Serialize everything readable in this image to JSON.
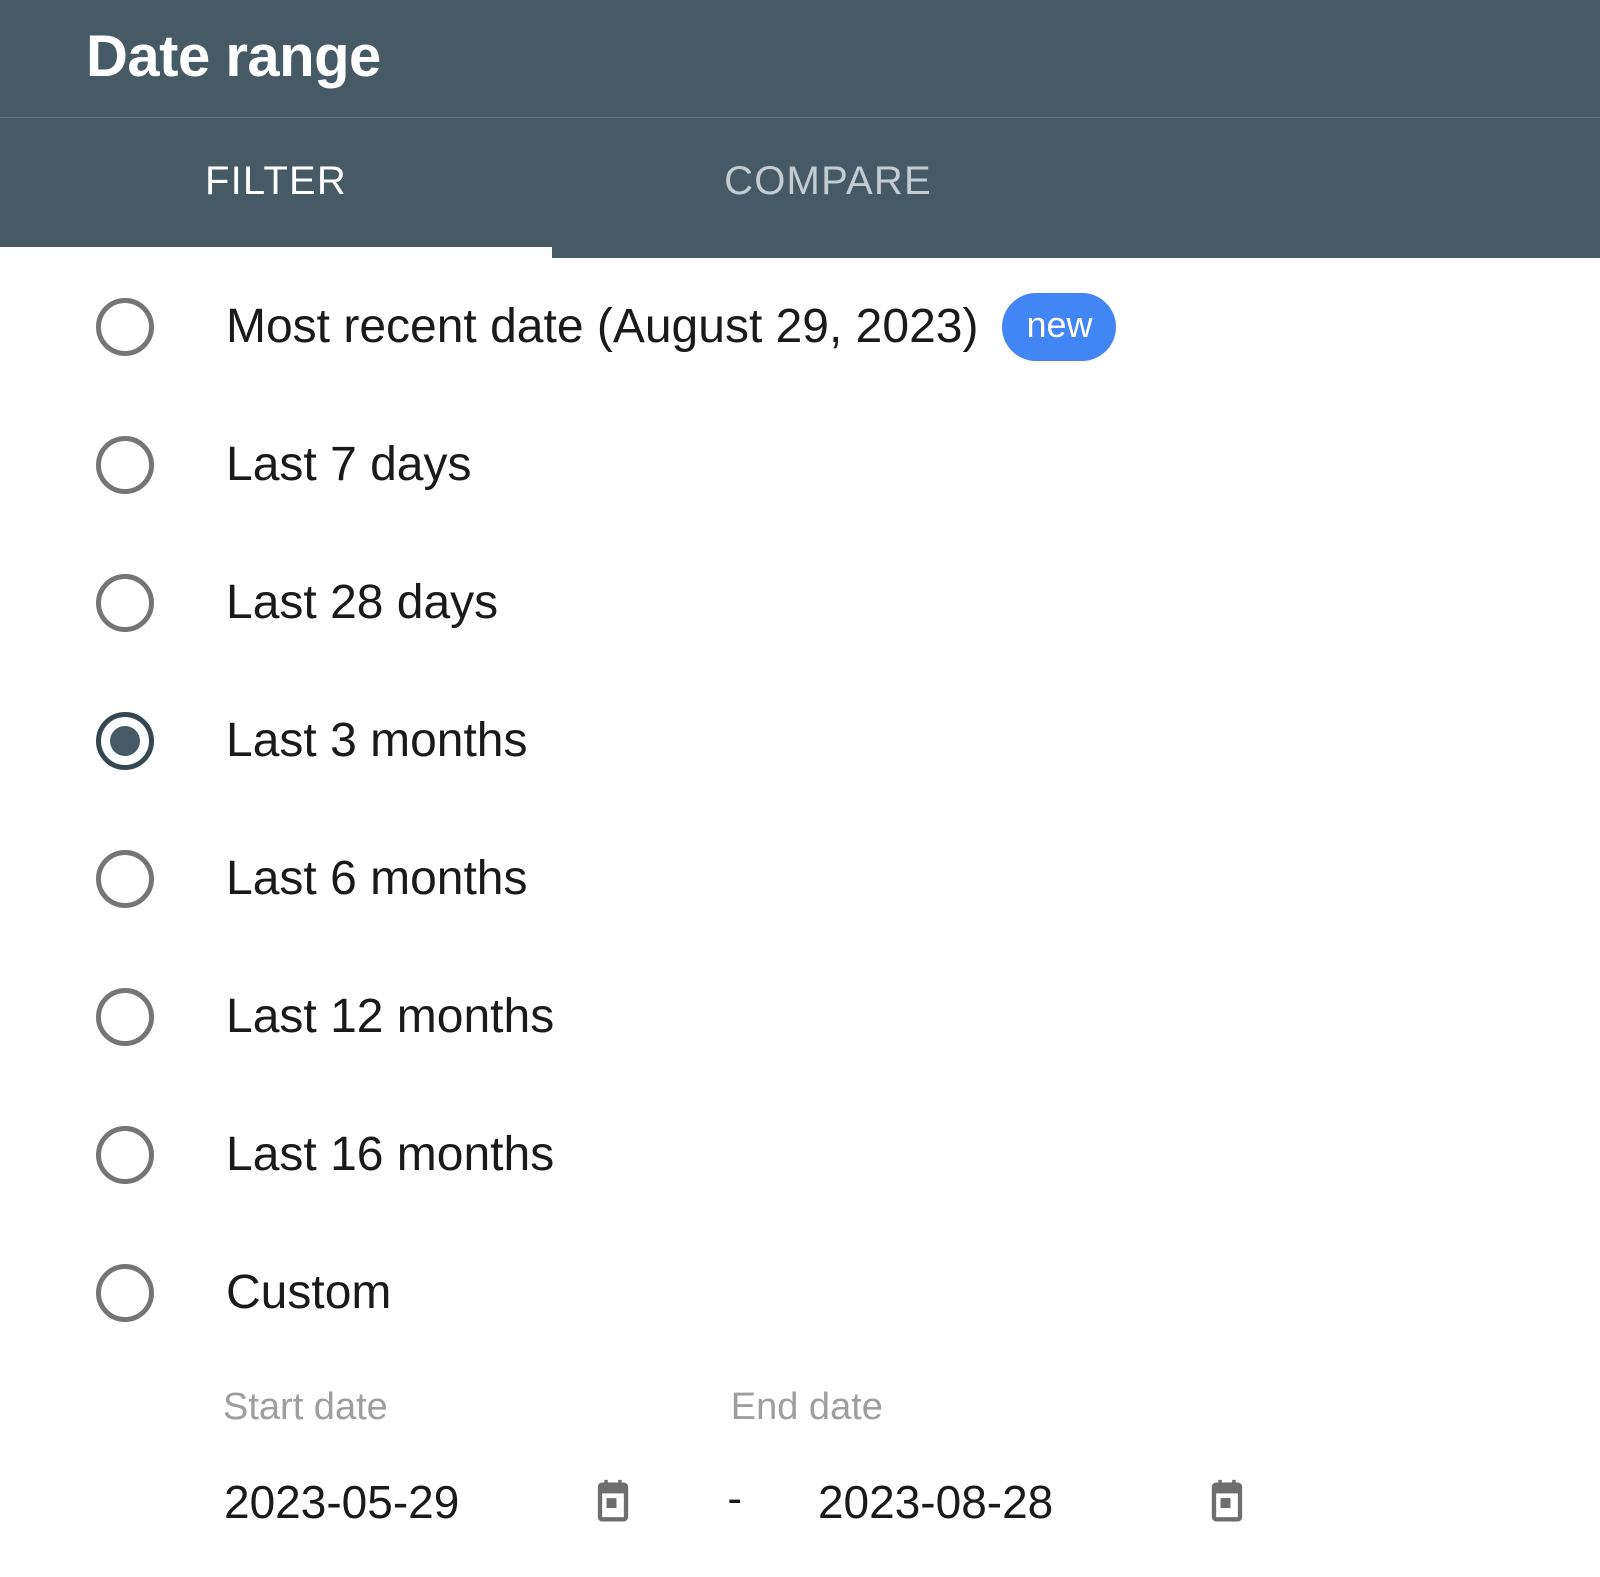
{
  "header": {
    "title": "Date range"
  },
  "tabs": [
    {
      "label": "FILTER",
      "active": true
    },
    {
      "label": "COMPARE",
      "active": false
    }
  ],
  "options": [
    {
      "label": "Most recent date (August 29, 2023)",
      "badge": "new",
      "selected": false
    },
    {
      "label": "Last 7 days",
      "selected": false
    },
    {
      "label": "Last 28 days",
      "selected": false
    },
    {
      "label": "Last 3 months",
      "selected": true
    },
    {
      "label": "Last 6 months",
      "selected": false
    },
    {
      "label": "Last 12 months",
      "selected": false
    },
    {
      "label": "Last 16 months",
      "selected": false
    },
    {
      "label": "Custom",
      "selected": false
    }
  ],
  "custom": {
    "start_label": "Start date",
    "end_label": "End date",
    "start_value": "2023-05-29",
    "end_value": "2023-08-28",
    "separator": "-",
    "start_calendar_icon": "calendar-icon",
    "end_calendar_icon": "calendar-icon"
  },
  "colors": {
    "header_bg": "#455a64",
    "badge_bg": "#4285f4",
    "selected_radio": "#37474f",
    "unselected_radio": "#757575",
    "inactive_tab_text": "#c3ccd1",
    "muted_label": "#9e9e9e"
  }
}
